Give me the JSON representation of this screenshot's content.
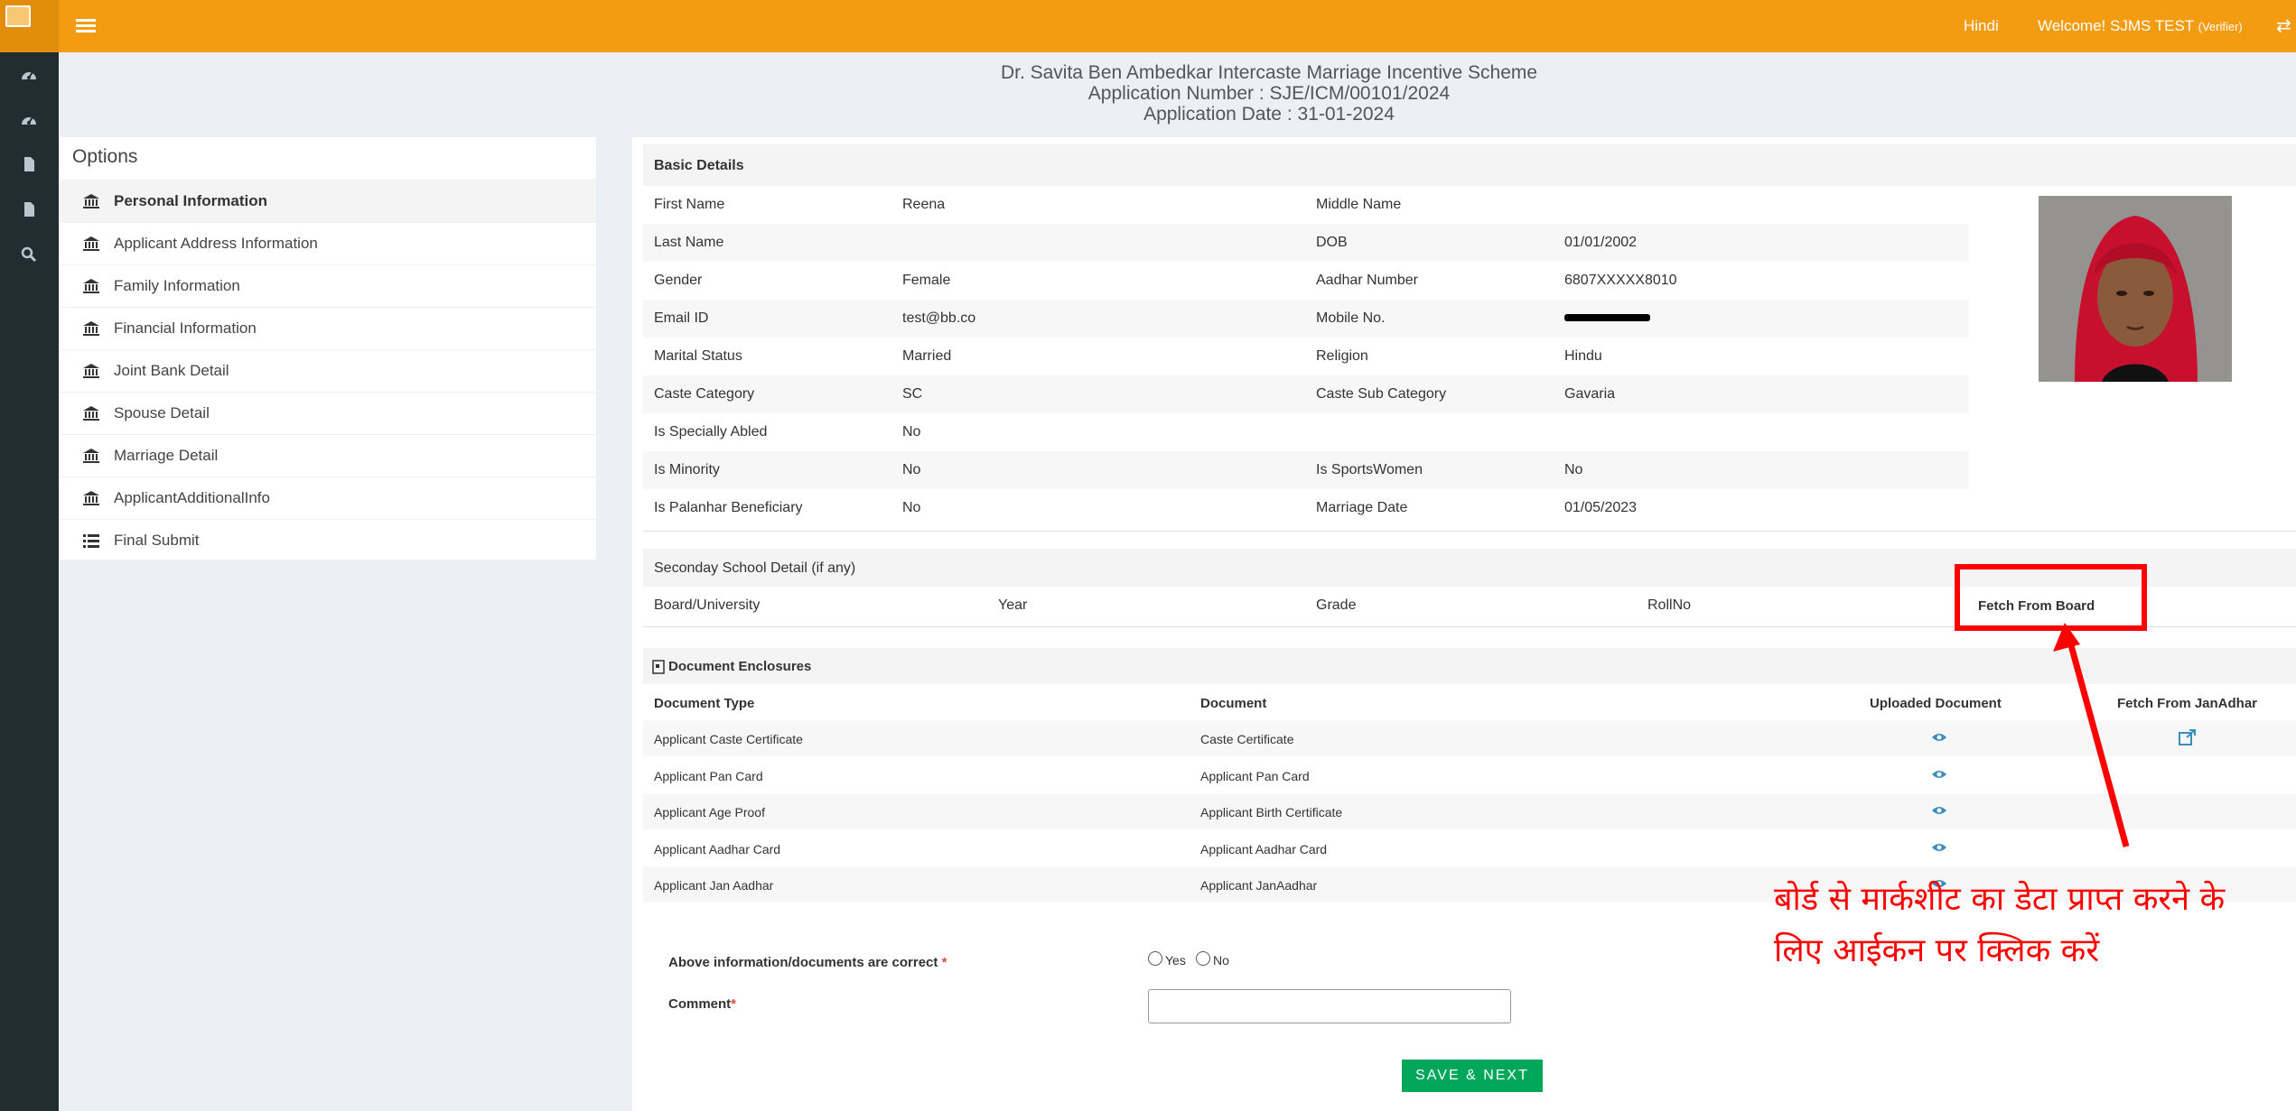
{
  "topbar": {
    "language_link": "Hindi",
    "welcome_text": "Welcome! SJMS TEST",
    "role": "(Verifier)",
    "menu_icon": "hamburger-icon",
    "swap_icon": "swap-icon"
  },
  "rail": {
    "icons": [
      "dashboard-icon",
      "dashboard-icon",
      "file-icon",
      "file-icon",
      "search-icon"
    ]
  },
  "header": {
    "scheme_title": "Dr. Savita Ben Ambedkar Intercaste Marriage Incentive Scheme",
    "application_number": "Application Number : SJE/ICM/00101/2024",
    "application_date": "Application Date : 31-01-2024"
  },
  "options": {
    "title": "Options",
    "items": [
      {
        "label": "Personal Information",
        "icon": "bank-icon"
      },
      {
        "label": "Applicant Address Information",
        "icon": "bank-icon"
      },
      {
        "label": "Family Information",
        "icon": "bank-icon"
      },
      {
        "label": "Financial Information",
        "icon": "bank-icon"
      },
      {
        "label": "Joint Bank Detail",
        "icon": "bank-icon"
      },
      {
        "label": "Spouse Detail",
        "icon": "bank-icon"
      },
      {
        "label": "Marriage Detail",
        "icon": "bank-icon"
      },
      {
        "label": "ApplicantAdditionalInfo",
        "icon": "bank-icon"
      },
      {
        "label": "Final Submit",
        "icon": "list-icon"
      }
    ]
  },
  "basic_details": {
    "title": "Basic Details",
    "rows": [
      [
        "First Name",
        "Reena",
        "Middle Name",
        ""
      ],
      [
        "Last Name",
        "",
        "DOB",
        "01/01/2002"
      ],
      [
        "Gender",
        "Female",
        "Aadhar Number",
        "6807XXXXX8010"
      ],
      [
        "Email ID",
        "test@bb.co",
        "Mobile No.",
        ""
      ],
      [
        "Marital Status",
        "Married",
        "Religion",
        "Hindu"
      ],
      [
        "Caste Category",
        "SC",
        "Caste Sub Category",
        "Gavaria"
      ],
      [
        "Is Specially Abled",
        "No",
        "",
        ""
      ],
      [
        "Is Minority",
        "No",
        "Is SportsWomen",
        "No"
      ],
      [
        "Is Palanhar Beneficiary",
        "No",
        "Marriage Date",
        "01/05/2023"
      ]
    ]
  },
  "school": {
    "title": "Seconday School Detail (if any)",
    "columns": [
      "Board/University",
      "Year",
      "Grade",
      "RollNo",
      "Fetch From Board"
    ]
  },
  "documents": {
    "title": "Document Enclosures",
    "columns": [
      "Document Type",
      "Document",
      "Uploaded Document",
      "Fetch From JanAdhar"
    ],
    "rows": [
      [
        "Applicant Caste Certificate",
        "Caste Certificate"
      ],
      [
        "Applicant Pan Card",
        "Applicant Pan Card"
      ],
      [
        "Applicant Age Proof",
        "Applicant Birth Certificate"
      ],
      [
        "Applicant Aadhar Card",
        "Applicant Aadhar Card"
      ],
      [
        "Applicant Jan Aadhar",
        "Applicant JanAadhar"
      ]
    ]
  },
  "form": {
    "confirm_label": "Above information/documents are correct",
    "required_mark": "*",
    "yes": "Yes",
    "no": "No",
    "comment_label": "Comment",
    "comment_value": "",
    "save_button": "SAVE & NEXT"
  },
  "annotation": {
    "text": "बोर्ड  से मार्कशीट का डेटा प्राप्त करने के लिए आईकन पर क्लिक करें",
    "color": "#ff0000"
  },
  "colors": {
    "topbar": "#f39c12",
    "rail": "#222d32",
    "save": "#00a65a",
    "highlight": "#ff0000"
  }
}
